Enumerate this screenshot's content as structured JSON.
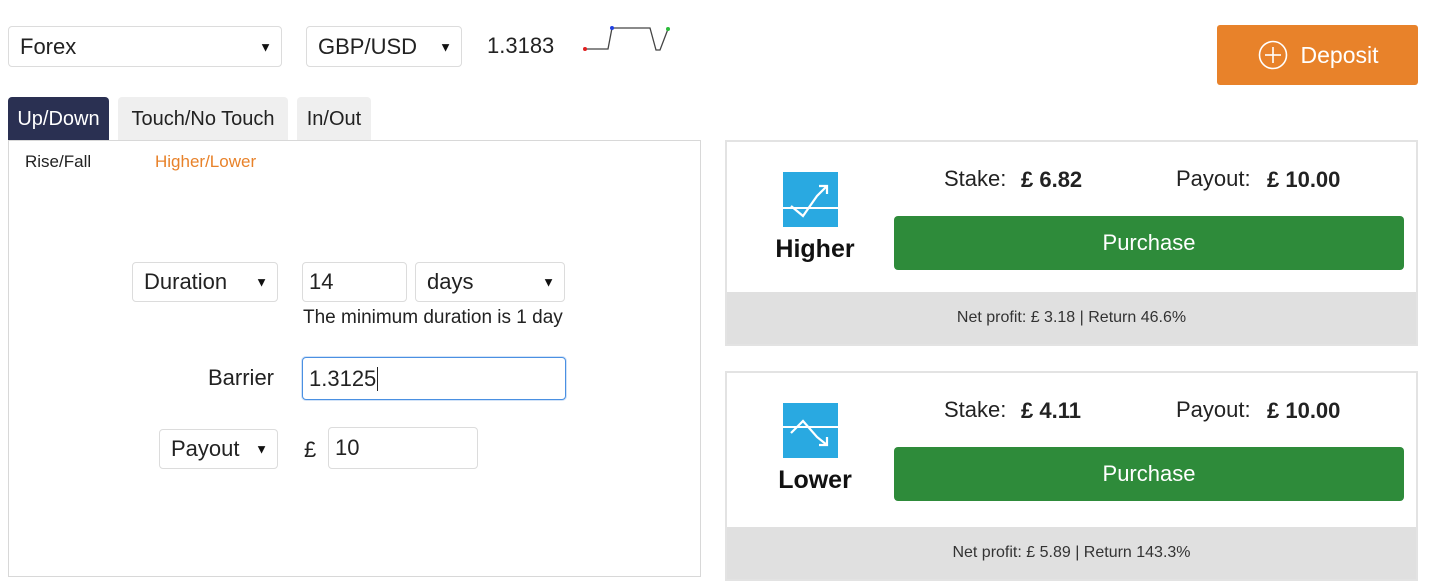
{
  "top_bar": {
    "market_select": "Forex",
    "symbol_select": "GBP/USD",
    "spot_price": "1.3183",
    "deposit_label": "Deposit"
  },
  "tabs": [
    "Up/Down",
    "Touch/No Touch",
    "In/Out"
  ],
  "subtabs": [
    "Rise/Fall",
    "Higher/Lower"
  ],
  "form": {
    "duration_type": "Duration",
    "duration_value": "14",
    "duration_unit": "days",
    "duration_hint": "The minimum duration is 1 day",
    "barrier_label": "Barrier",
    "barrier_value": "1.3125",
    "amount_type": "Payout",
    "currency_symbol": "£",
    "amount_value": "10"
  },
  "contracts": [
    {
      "direction": "Higher",
      "stake_label": "Stake:",
      "stake_value": "£ 6.82",
      "payout_label": "Payout:",
      "payout_value": "£ 10.00",
      "purchase_label": "Purchase",
      "net_info": "Net profit: £ 3.18 | Return 46.6%"
    },
    {
      "direction": "Lower",
      "stake_label": "Stake:",
      "stake_value": "£ 4.11",
      "payout_label": "Payout:",
      "payout_value": "£ 10.00",
      "purchase_label": "Purchase",
      "net_info": "Net profit: £ 5.89 | Return 143.3%"
    }
  ],
  "colors": {
    "active_tab": "#2a3052",
    "accent_orange": "#e8822a",
    "purchase_green": "#2e8b3a",
    "icon_blue": "#29a9e1"
  },
  "icons": {
    "deposit": "plus-circle-icon",
    "higher": "trend-up-icon",
    "lower": "trend-down-icon",
    "select": "caret-down-icon"
  }
}
